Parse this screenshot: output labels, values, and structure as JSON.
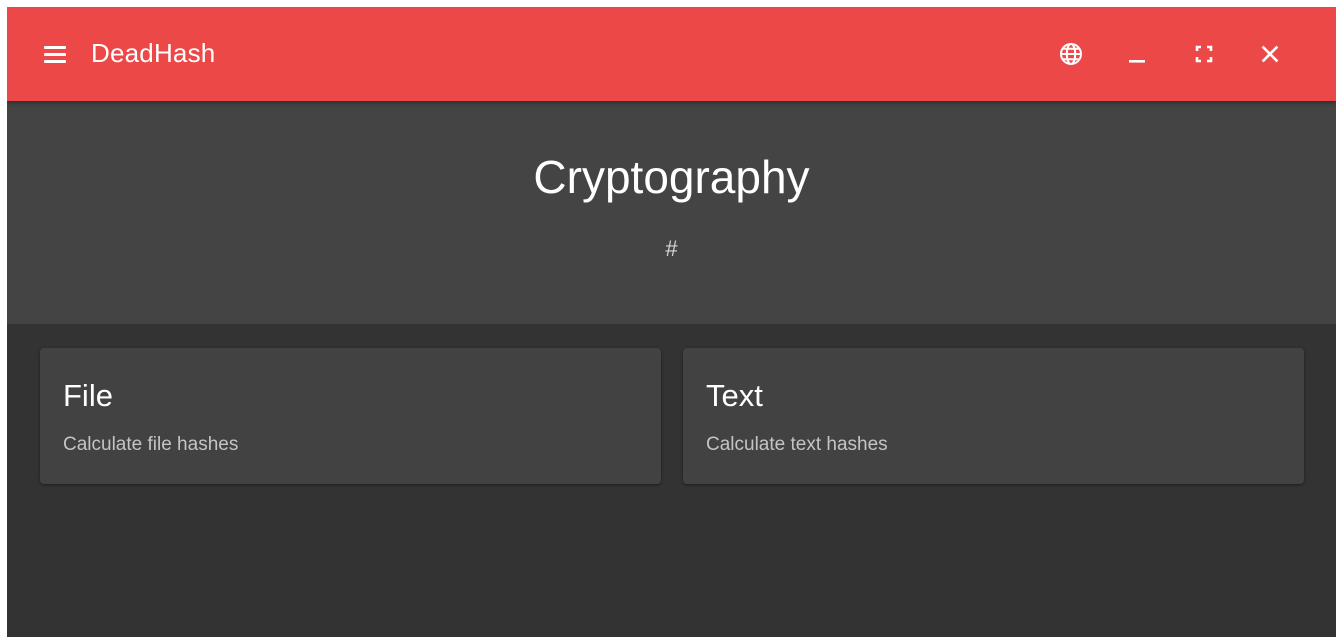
{
  "app": {
    "title": "DeadHash",
    "accent_color": "#ec4848"
  },
  "toolbar": {
    "menu_icon": "hamburger-menu-icon",
    "language_icon": "globe-icon",
    "minimize_icon": "minimize-icon",
    "fullscreen_icon": "fullscreen-icon",
    "close_icon": "close-icon"
  },
  "hero": {
    "title": "Cryptography",
    "subtitle": "#"
  },
  "cards": [
    {
      "title": "File",
      "description": "Calculate file hashes"
    },
    {
      "title": "Text",
      "description": "Calculate text hashes"
    }
  ]
}
